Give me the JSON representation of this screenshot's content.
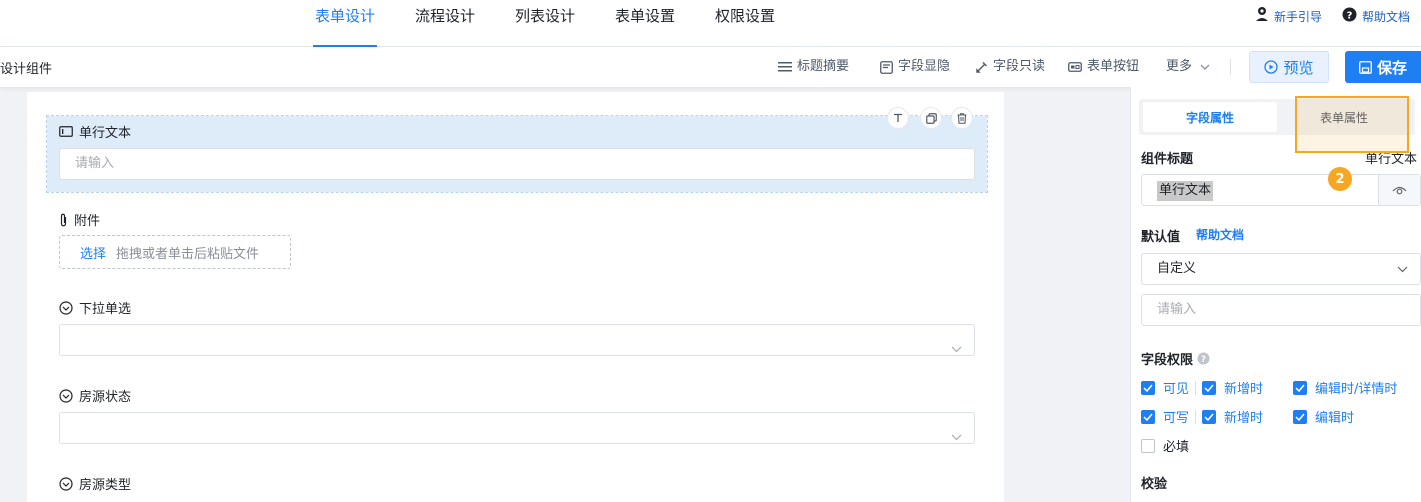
{
  "nav": {
    "tabs": [
      {
        "label": "表单设计",
        "active": true
      },
      {
        "label": "流程设计",
        "active": false
      },
      {
        "label": "列表设计",
        "active": false
      },
      {
        "label": "表单设置",
        "active": false
      },
      {
        "label": "权限设置",
        "active": false
      }
    ],
    "guide_label": "新手引导",
    "help_label": "帮助文档"
  },
  "toolbar": {
    "left_label": "设计组件",
    "items": {
      "title_summary": "标题摘要",
      "field_visibility": "字段显隐",
      "field_readonly": "字段只读",
      "form_buttons": "表单按钮",
      "more": "更多"
    },
    "preview_label": "预览",
    "save_label": "保存"
  },
  "canvas": {
    "fields": [
      {
        "label": "单行文本",
        "type": "text",
        "placeholder": "请输入",
        "selected": true
      },
      {
        "label": "附件",
        "type": "upload",
        "choose_label": "选择",
        "hint": "拖拽或者单击后粘贴文件"
      },
      {
        "label": "下拉单选",
        "type": "select"
      },
      {
        "label": "房源状态",
        "type": "select"
      },
      {
        "label": "房源类型",
        "type": "select"
      }
    ]
  },
  "panel": {
    "tabs": [
      {
        "label": "字段属性",
        "active": true
      },
      {
        "label": "表单属性",
        "active": false
      }
    ],
    "step_number": "2",
    "component_title_label": "组件标题",
    "component_title_hint": "单行文本",
    "component_title_value": "单行文本",
    "default_label": "默认值",
    "default_help": "帮助文档",
    "default_mode": "自定义",
    "default_placeholder": "请输入",
    "permission_label": "字段权限",
    "perm_rows": [
      {
        "main": "可见",
        "a": "新增时",
        "b": "编辑时/详情时"
      },
      {
        "main": "可写",
        "a": "新增时",
        "b": "编辑时"
      }
    ],
    "required_label": "必填",
    "validation_label": "校验"
  },
  "colors": {
    "accent": "#1e7ff2",
    "highlight": "#f5a623",
    "selected_bg": "#deebf9"
  }
}
